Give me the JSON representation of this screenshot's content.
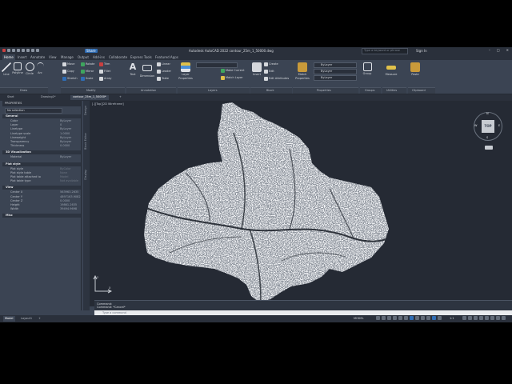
{
  "titlebar": {
    "share_label": "Share",
    "window_title": "Autodesk AutoCAD 2022   contour_25m_1_50000.dwg",
    "search_placeholder": "Type a keyword or phrase",
    "signin_label": "Sign In"
  },
  "ribbon_tabs": [
    "Home",
    "Insert",
    "Annotate",
    "View",
    "Manage",
    "Output",
    "Add-ins",
    "Collaborate",
    "Express Tools",
    "Featured Apps"
  ],
  "ribbon": {
    "draw": {
      "line": "Line",
      "polyline": "Polyline",
      "circle": "Circle",
      "arc": "Arc",
      "panel": "Draw"
    },
    "modify": {
      "move": "Move",
      "rotate": "Rotate",
      "trim": "Trim",
      "copy": "Copy",
      "mirror": "Mirror",
      "fillet": "Fillet",
      "stretch": "Stretch",
      "scale": "Scale",
      "array": "Array",
      "panel": "Modify"
    },
    "annotation": {
      "text": "Text",
      "dimension": "Dimension",
      "linear": "Linear",
      "leader": "Leader",
      "table": "Table",
      "panel": "Annotation"
    },
    "layers": {
      "layer_properties": "Layer Properties",
      "make_current": "Make Current",
      "match_layer": "Match Layer",
      "panel": "Layers"
    },
    "block": {
      "insert": "Insert",
      "create": "Create",
      "edit": "Edit",
      "edit_attributes": "Edit Attributes",
      "panel": "Block"
    },
    "properties": {
      "match_properties": "Match Properties",
      "bylayer": "ByLayer",
      "panel": "Properties"
    },
    "groups": {
      "group": "Group",
      "panel": "Groups"
    },
    "utilities": {
      "measure": "Measure",
      "panel": "Utilities"
    },
    "clipboard": {
      "paste": "Paste",
      "panel": "Clipboard"
    }
  },
  "file_tabs": [
    "Start",
    "Drawing1*",
    "contour_25m_1_50000*"
  ],
  "properties_palette": {
    "title": "PROPERTIES",
    "selection": "No selection",
    "sections": [
      {
        "name": "General",
        "rows": [
          {
            "key": "Color",
            "value": "ByLayer"
          },
          {
            "key": "Layer",
            "value": "0"
          },
          {
            "key": "Linetype",
            "value": "ByLayer"
          },
          {
            "key": "Linetype scale",
            "value": "1.0000"
          },
          {
            "key": "Lineweight",
            "value": "ByLayer"
          },
          {
            "key": "Transparency",
            "value": "ByLayer"
          },
          {
            "key": "Thickness",
            "value": "0.0000"
          }
        ]
      },
      {
        "name": "3D Visualization",
        "rows": [
          {
            "key": "Material",
            "value": "ByLayer"
          }
        ]
      },
      {
        "name": "Plot style",
        "rows": [
          {
            "key": "Plot style",
            "value": "ByColor"
          },
          {
            "key": "Plot style table",
            "value": "None"
          },
          {
            "key": "Plot table attached to",
            "value": "Model"
          },
          {
            "key": "Plot table type",
            "value": "Not available"
          }
        ]
      },
      {
        "name": "View",
        "rows": [
          {
            "key": "Center X",
            "value": "563963.2635"
          },
          {
            "key": "Center Y",
            "value": "4897163.9082"
          },
          {
            "key": "Center Z",
            "value": "0.0000"
          },
          {
            "key": "Height",
            "value": "19861.2635"
          },
          {
            "key": "Width",
            "value": "39494.9698"
          }
        ]
      },
      {
        "name": "Misc",
        "rows": []
      }
    ]
  },
  "side_tabs": [
    "Design",
    "Block Editor",
    "Display"
  ],
  "viewport": {
    "label": "[-][Top][2D Wireframe]",
    "viewcube_top": "TOP",
    "compass": {
      "n": "N",
      "s": "S",
      "e": "E",
      "w": "W"
    },
    "ucs": {
      "x": "X",
      "y": "Y"
    }
  },
  "command": {
    "history": [
      "Command:",
      "Command: *Cancel*"
    ],
    "input_placeholder": "Type a command"
  },
  "status_bar": {
    "tabs": [
      "Model",
      "Layout1"
    ],
    "model_label": "MODEL",
    "scale": "1:1"
  },
  "colors": {
    "accent": "#2f6db5",
    "background": "#252a34",
    "panel": "#3b4453"
  }
}
